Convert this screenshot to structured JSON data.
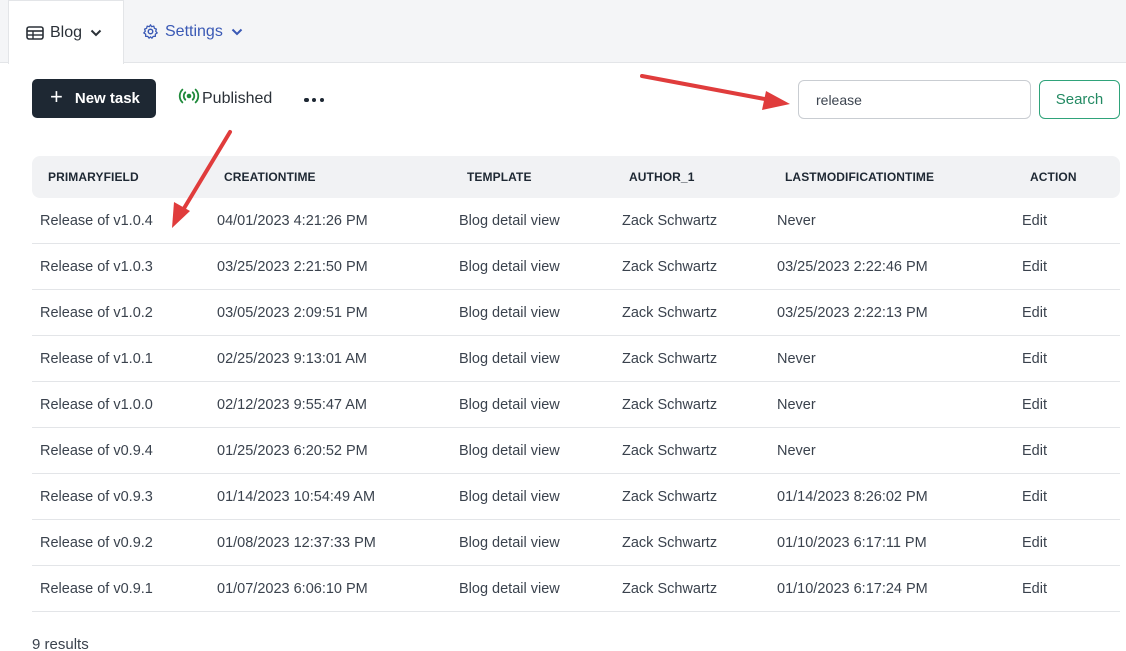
{
  "tabs": [
    {
      "label": "Blog",
      "icon": "table-icon"
    },
    {
      "label": "Settings",
      "icon": "gear-icon"
    }
  ],
  "toolbar": {
    "new_task_label": "New task",
    "published_label": "Published",
    "more_icon": "more-horizontal-icon"
  },
  "search": {
    "value": "release",
    "button_label": "Search"
  },
  "table": {
    "columns": [
      "PRIMARYFIELD",
      "CREATIONTIME",
      "TEMPLATE",
      "AUTHOR_1",
      "LASTMODIFICATIONTIME",
      "ACTION"
    ],
    "rows": [
      [
        "Release of v1.0.4",
        "04/01/2023 4:21:26 PM",
        "Blog detail view",
        "Zack Schwartz",
        "Never",
        "Edit"
      ],
      [
        "Release of v1.0.3",
        "03/25/2023 2:21:50 PM",
        "Blog detail view",
        "Zack Schwartz",
        "03/25/2023 2:22:46 PM",
        "Edit"
      ],
      [
        "Release of v1.0.2",
        "03/05/2023 2:09:51 PM",
        "Blog detail view",
        "Zack Schwartz",
        "03/25/2023 2:22:13 PM",
        "Edit"
      ],
      [
        "Release of v1.0.1",
        "02/25/2023 9:13:01 AM",
        "Blog detail view",
        "Zack Schwartz",
        "Never",
        "Edit"
      ],
      [
        "Release of v1.0.0",
        "02/12/2023 9:55:47 AM",
        "Blog detail view",
        "Zack Schwartz",
        "Never",
        "Edit"
      ],
      [
        "Release of v0.9.4",
        "01/25/2023 6:20:52 PM",
        "Blog detail view",
        "Zack Schwartz",
        "Never",
        "Edit"
      ],
      [
        "Release of v0.9.3",
        "01/14/2023 10:54:49 AM",
        "Blog detail view",
        "Zack Schwartz",
        "01/14/2023 8:26:02 PM",
        "Edit"
      ],
      [
        "Release of v0.9.2",
        "01/08/2023 12:37:33 PM",
        "Blog detail view",
        "Zack Schwartz",
        "01/10/2023 6:17:11 PM",
        "Edit"
      ],
      [
        "Release of v0.9.1",
        "01/07/2023 6:06:10 PM",
        "Blog detail view",
        "Zack Schwartz",
        "01/10/2023 6:17:24 PM",
        "Edit"
      ]
    ]
  },
  "results_label": "9 results",
  "colors": {
    "primary_button": "#1e2833",
    "settings_link": "#3a59b5",
    "published_icon": "#1f8a3b",
    "search_button": "#2fa37a",
    "annotation_arrow": "#e03c3c"
  }
}
